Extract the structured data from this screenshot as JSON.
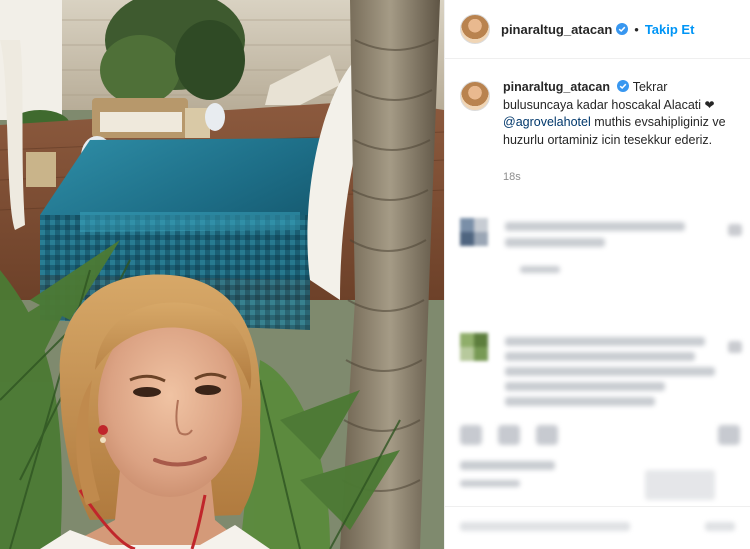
{
  "post": {
    "username": "pinaraltug_atacan",
    "follow_label": "Takip Et",
    "separator": "•",
    "caption_text": "Tekrar bulusuncaya kadar hoscakal Alacati",
    "heart": "❤",
    "mention": "@agrovelahotel",
    "caption_rest": "muthis evsahipliginiz ve huzurlu ortaminiz icin tesekkur ederiz.",
    "time": "18s"
  },
  "colors": {
    "accent": "#0095f6",
    "mention": "#00376b",
    "muted": "#8e8e8e"
  },
  "icons": [
    "verified-badge-icon",
    "heart-icon",
    "like-icon",
    "comment-icon",
    "share-icon",
    "save-icon"
  ]
}
